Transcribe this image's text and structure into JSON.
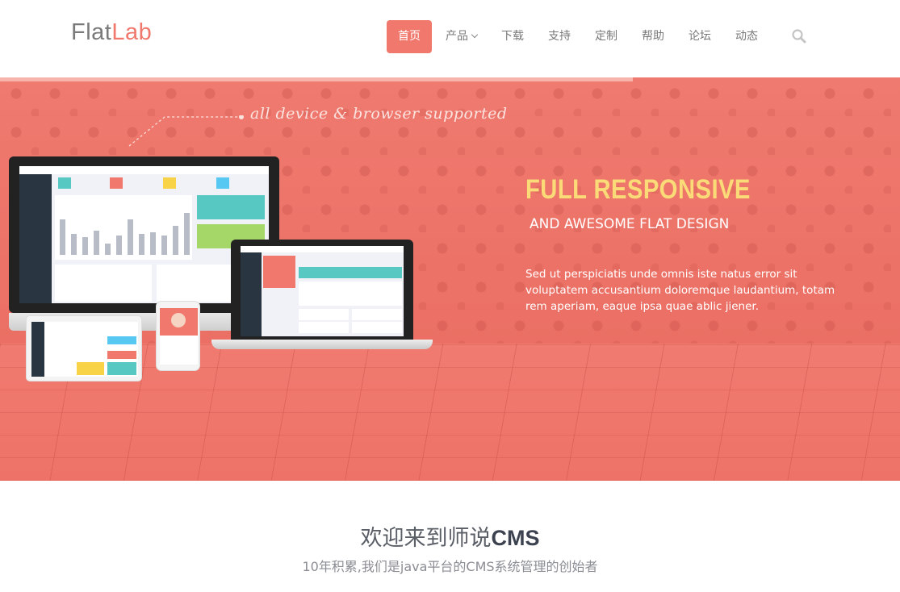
{
  "brand": {
    "part1": "Flat",
    "part2": "Lab"
  },
  "nav": {
    "items": [
      {
        "label": "首页"
      },
      {
        "label": "产品"
      },
      {
        "label": "下载"
      },
      {
        "label": "支持"
      },
      {
        "label": "定制"
      },
      {
        "label": "帮助"
      },
      {
        "label": "论坛"
      },
      {
        "label": "动态"
      }
    ],
    "search_icon": "search-icon"
  },
  "hero": {
    "tagline": "all device & browser supported",
    "title": "FULL RESPONSIVE",
    "subtitle": "AND AWESOME FLAT DESIGN",
    "description": "Sed ut perspiciatis unde omnis iste natus error sit voluptatem accusantium doloremque laudantium, totam rem aperiam, eaque ipsa quae ablic jiener."
  },
  "welcome": {
    "title_prefix": "欢迎来到师说",
    "title_cms": "CMS",
    "subtitle": "10年积累,我们是java平台的CMS系统管理的创始者"
  },
  "colors": {
    "accent": "#f0786c",
    "hero_title": "#fbdb78",
    "text_muted": "#797979"
  }
}
